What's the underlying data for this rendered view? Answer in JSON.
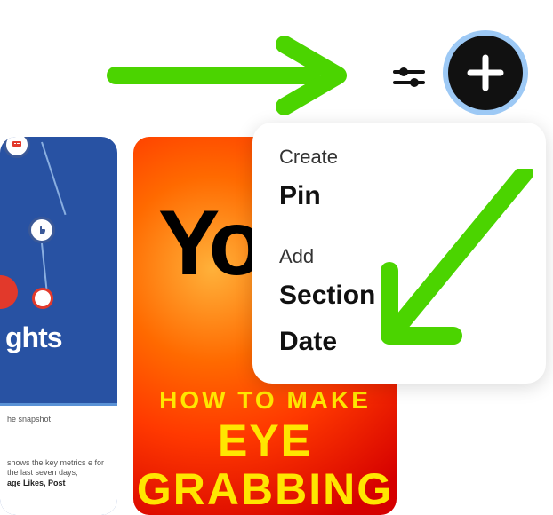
{
  "toolbar": {
    "filter_icon": "filter",
    "add_icon": "plus"
  },
  "dropdown": {
    "create_label": "Create",
    "create_items": [
      "Pin"
    ],
    "add_label": "Add",
    "add_items": [
      "Section",
      "Date"
    ]
  },
  "pins": {
    "left": {
      "partial_title": "ghts",
      "panel_heading": "he snapshot",
      "panel_text_1": "shows the key metrics e for the last seven days,",
      "panel_bold": "age Likes, Post"
    },
    "right": {
      "partial_word": "You",
      "line1": "HOW TO MAKE",
      "line2": "EYE GRABBING"
    }
  },
  "colors": {
    "accent_green": "#4bd400",
    "add_ring": "#9dc9f5"
  }
}
